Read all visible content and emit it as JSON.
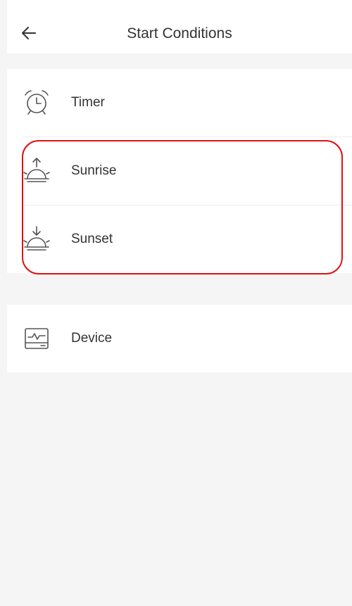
{
  "header": {
    "title": "Start Conditions",
    "back_icon": "arrow-left-icon"
  },
  "conditions": [
    {
      "label": "Timer",
      "icon": "alarm-clock-icon"
    },
    {
      "label": "Sunrise",
      "icon": "sunrise-icon"
    },
    {
      "label": "Sunset",
      "icon": "sunset-icon"
    }
  ],
  "device_group": [
    {
      "label": "Device",
      "icon": "device-monitor-icon"
    }
  ],
  "colors": {
    "highlight": "#e11010",
    "background": "#f5f5f5",
    "text": "#333333",
    "icon": "#555555"
  }
}
